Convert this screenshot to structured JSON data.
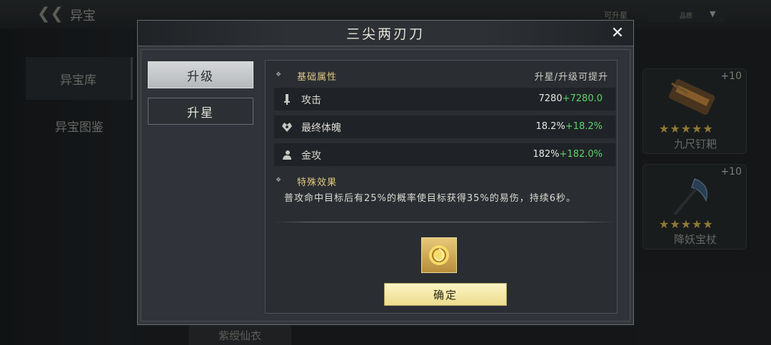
{
  "background": {
    "title": "异宝",
    "filter_label": "可升星",
    "filter_value": "品质",
    "left_tabs": [
      {
        "label": "异宝库",
        "active": true
      },
      {
        "label": "异宝图鉴",
        "active": false
      }
    ],
    "cards": [
      {
        "name": "九尺钉耙",
        "level": "+10",
        "stars": "★★★★★"
      },
      {
        "name": "降妖宝杖",
        "level": "+10",
        "stars": "★★★★★"
      }
    ],
    "bottom_card_name": "紫绶仙衣"
  },
  "dialog": {
    "title": "三尖两刃刀",
    "close_icon": "close-icon",
    "tabs": [
      {
        "label": "升级",
        "active": true
      },
      {
        "label": "升星",
        "active": false
      }
    ],
    "base_section": {
      "title": "基础属性",
      "right_label": "升星/升级可提升",
      "stats": [
        {
          "icon": "sword-icon",
          "name": "攻击",
          "base": "7280",
          "bonus": "+7280.0"
        },
        {
          "icon": "heart-icon",
          "name": "最终体魄",
          "base": "18.2%",
          "bonus": "+18.2%"
        },
        {
          "icon": "metal-icon",
          "name": "金攻",
          "base": "182%",
          "bonus": "+182.0%"
        }
      ]
    },
    "special_section": {
      "title": "特殊效果",
      "text": "普攻命中目标后有25%的概率使目标获得35%的易伤，持续6秒。"
    },
    "confirm_label": "确定"
  },
  "colors": {
    "accent_gold": "#e0c77e",
    "bonus_green": "#5fd46a",
    "confirm_button": "#f5eaa8"
  }
}
